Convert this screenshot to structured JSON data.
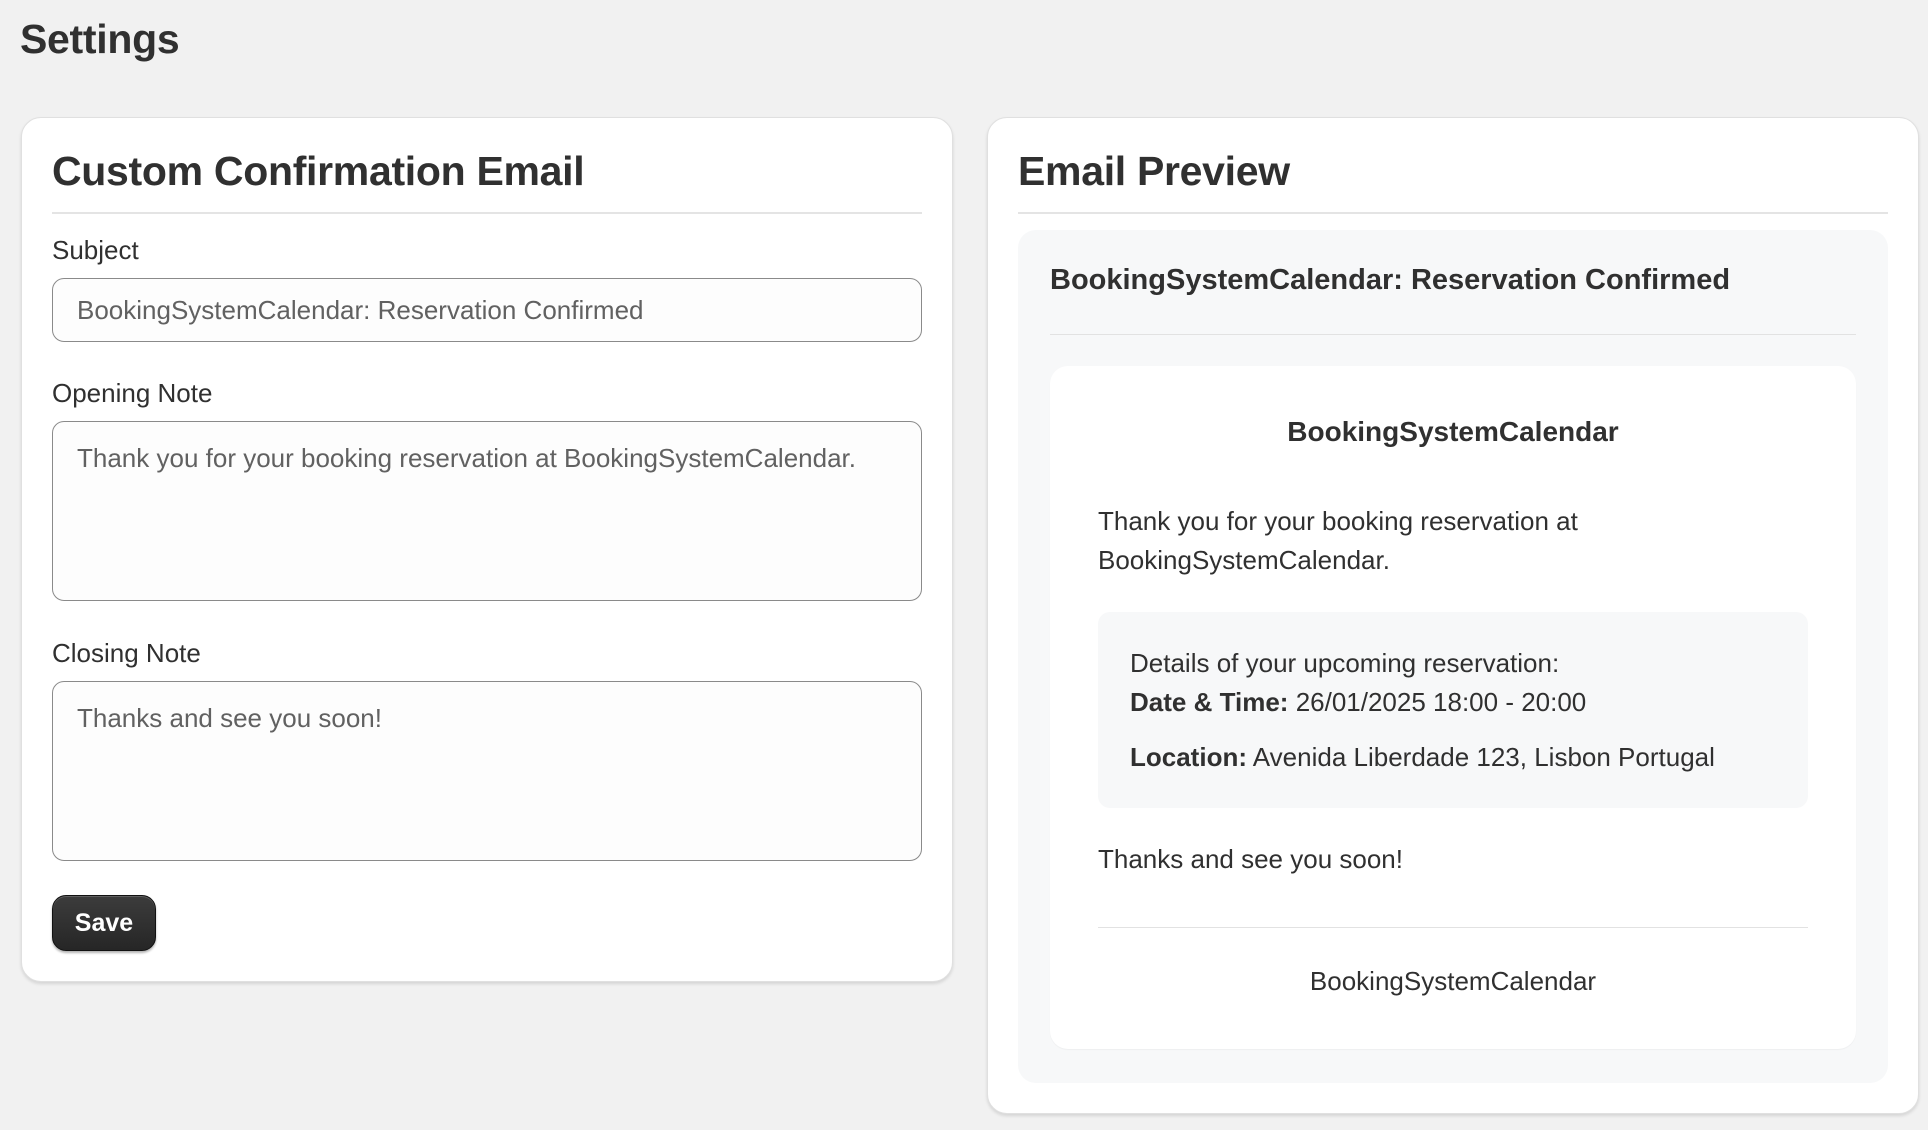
{
  "page": {
    "title": "Settings"
  },
  "form": {
    "heading": "Custom Confirmation Email",
    "subject": {
      "label": "Subject",
      "value": "BookingSystemCalendar: Reservation Confirmed"
    },
    "opening_note": {
      "label": "Opening Note",
      "value": "Thank you for your booking reservation at BookingSystemCalendar."
    },
    "closing_note": {
      "label": "Closing Note",
      "value": "Thanks and see you soon!"
    },
    "save_label": "Save"
  },
  "preview": {
    "heading": "Email Preview",
    "subject": "BookingSystemCalendar: Reservation Confirmed",
    "brand": "BookingSystemCalendar",
    "opening": "Thank you for your booking reservation at BookingSystemCalendar.",
    "details": {
      "intro": "Details of your upcoming reservation:",
      "datetime_label": "Date & Time:",
      "datetime_value": "26/01/2025 18:00 - 20:00",
      "location_label": "Location:",
      "location_value": "Avenida Liberdade 123, Lisbon Portugal"
    },
    "closing": "Thanks and see you soon!",
    "footer": "BookingSystemCalendar"
  }
}
